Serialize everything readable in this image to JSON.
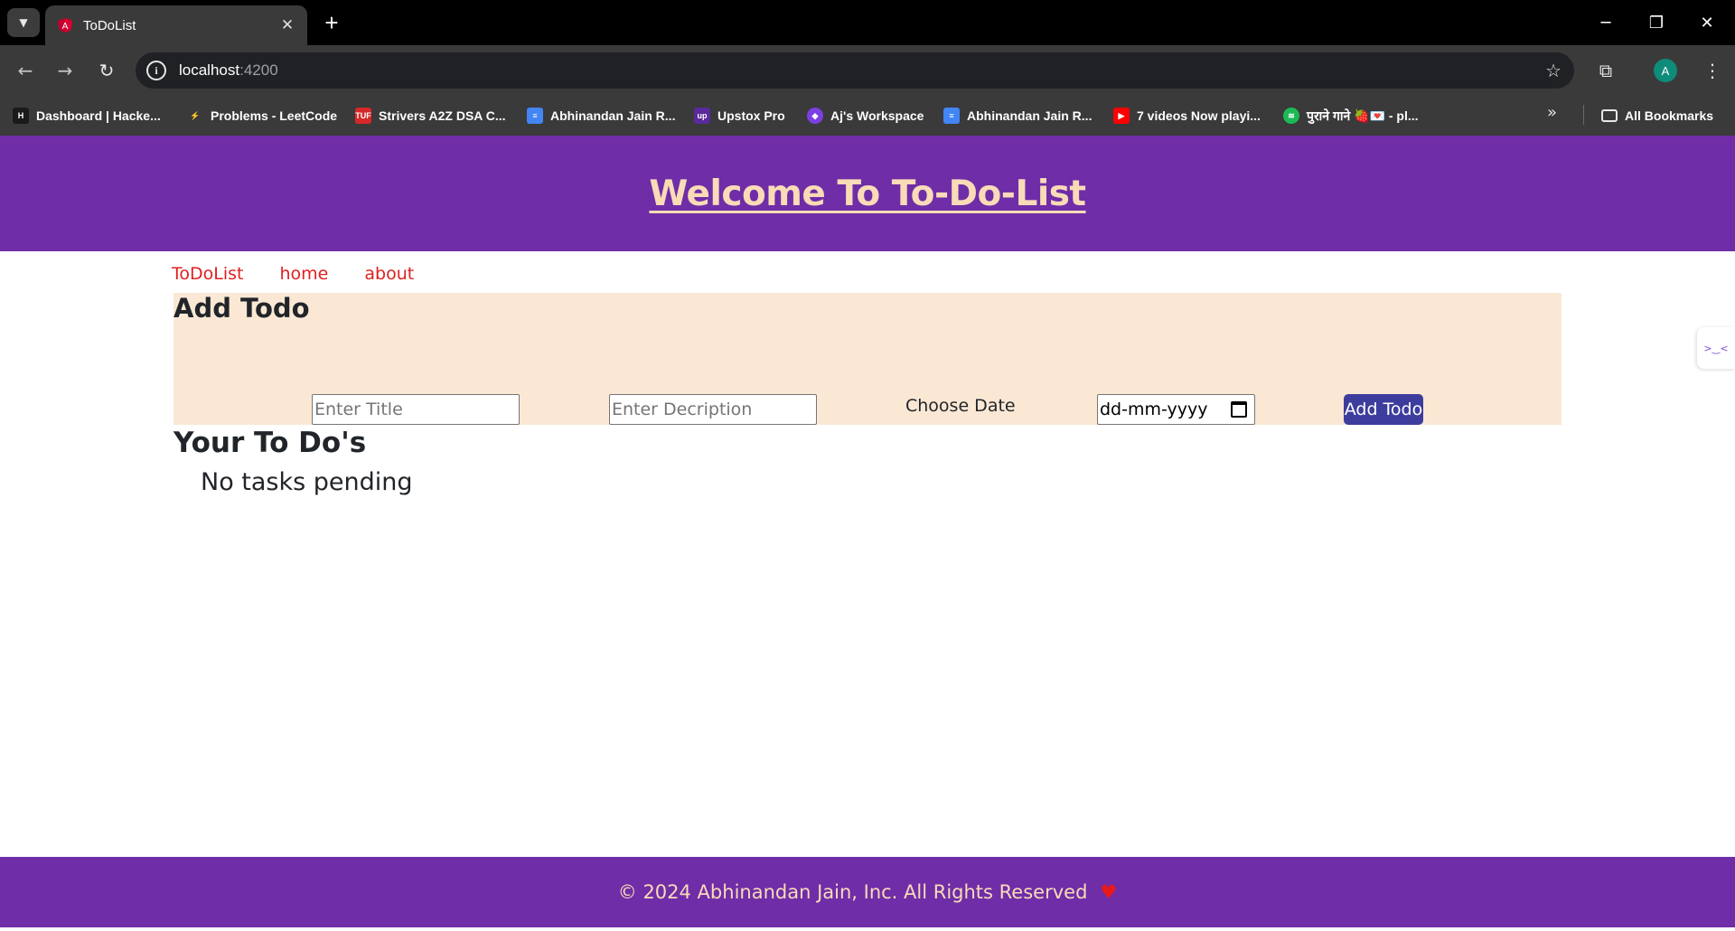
{
  "browser": {
    "tab_title": "ToDoList",
    "url_host": "localhost",
    "url_port": ":4200",
    "profile_initial": "A",
    "bookmarks": [
      {
        "label": "Dashboard | Hacke...",
        "icon": "hackerrank-icon",
        "color": "#1a1a1a"
      },
      {
        "label": "Problems - LeetCode",
        "icon": "leetcode-icon",
        "color": "#3a3a3a"
      },
      {
        "label": "Strivers A2Z DSA C...",
        "icon": "tuf-icon",
        "color": "#d62828"
      },
      {
        "label": "Abhinandan Jain R...",
        "icon": "docs-icon",
        "color": "#4285f4"
      },
      {
        "label": "Upstox Pro",
        "icon": "upstox-icon",
        "color": "#5a2a9a"
      },
      {
        "label": "Aj's Workspace",
        "icon": "workspace-icon",
        "color": "#7b3fe4"
      },
      {
        "label": "Abhinandan Jain R...",
        "icon": "docs-icon",
        "color": "#4285f4"
      },
      {
        "label": "7 videos Now playi...",
        "icon": "youtube-icon",
        "color": "#ff0000"
      },
      {
        "label": "पुराने गाने 🍓💌 - pl...",
        "icon": "spotify-icon",
        "color": "#1db954"
      }
    ],
    "all_bookmarks_label": "All Bookmarks"
  },
  "app": {
    "header_title": "Welcome To To-Do-List",
    "nav": [
      "ToDoList",
      "home",
      "about"
    ],
    "add_section_title": "Add Todo",
    "title_placeholder": "Enter Title",
    "description_placeholder": "Enter Decription",
    "choose_date_label": "Choose Date",
    "date_placeholder": "dd-mm-yyyy",
    "add_button_label": "Add Todo",
    "todos_title": "Your To Do's",
    "empty_message": "No tasks pending",
    "footer_text": "© 2024 Abhinandan Jain, Inc. All Rights Reserved",
    "footer_heart": "♥",
    "colors": {
      "primary_purple": "#6f2da8",
      "header_text": "#f9dbb7",
      "nav_link": "#e02020",
      "add_box_bg": "#fae8d5",
      "button_bg": "#3d3d9e"
    }
  }
}
